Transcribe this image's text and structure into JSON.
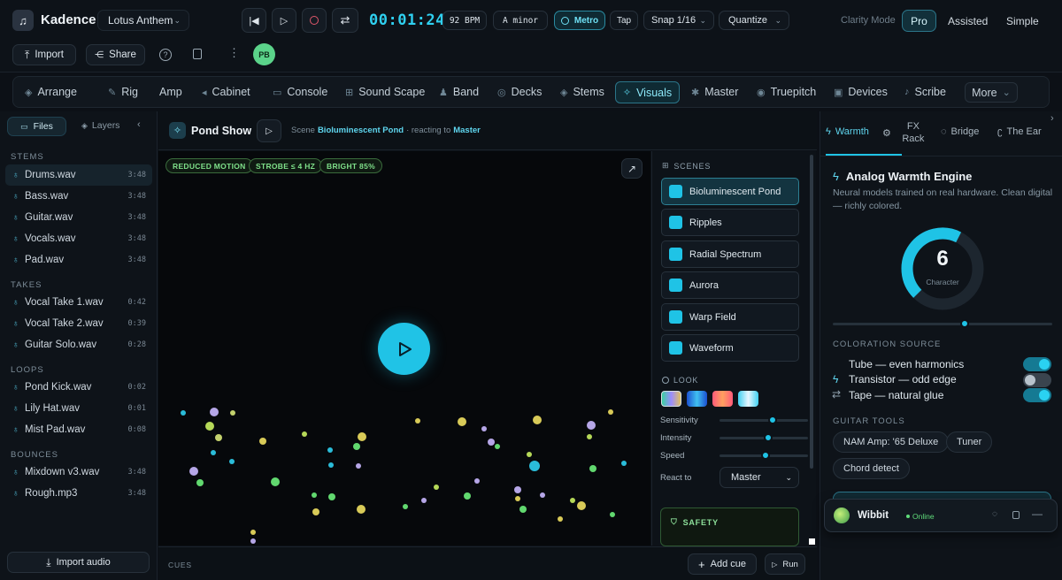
{
  "app": {
    "name": "Kadence",
    "project": "Lotus Anthem"
  },
  "transport": {
    "time": "00:01:24",
    "bpm": "92 BPM",
    "key": "A minor",
    "metro": "Metro",
    "tap": "Tap",
    "snap": "Snap 1/16",
    "quantize": "Quantize"
  },
  "clarity": {
    "label": "Clarity Mode",
    "options": [
      "Pro",
      "Assisted",
      "Simple"
    ],
    "active": "Pro"
  },
  "toolbar": {
    "import": "Import",
    "share": "Share",
    "avatar": "PB"
  },
  "nav": [
    "Arrange",
    "Rig",
    "Amp",
    "Cabinet",
    "Console",
    "Sound Scape",
    "Band",
    "Decks",
    "Stems",
    "Visuals",
    "Master",
    "Truepitch",
    "Devices",
    "Scribe",
    "More"
  ],
  "nav_active": "Visuals",
  "sidebar": {
    "tabs": [
      "Files",
      "Layers"
    ],
    "sections": [
      {
        "title": "STEMS",
        "files": [
          {
            "name": "Drums.wav",
            "dur": "3:48"
          },
          {
            "name": "Bass.wav",
            "dur": "3:48"
          },
          {
            "name": "Guitar.wav",
            "dur": "3:48"
          },
          {
            "name": "Vocals.wav",
            "dur": "3:48"
          },
          {
            "name": "Pad.wav",
            "dur": "3:48"
          }
        ]
      },
      {
        "title": "TAKES",
        "files": [
          {
            "name": "Vocal Take 1.wav",
            "dur": "0:42"
          },
          {
            "name": "Vocal Take 2.wav",
            "dur": "0:39"
          },
          {
            "name": "Guitar Solo.wav",
            "dur": "0:28"
          }
        ]
      },
      {
        "title": "LOOPS",
        "files": [
          {
            "name": "Pond Kick.wav",
            "dur": "0:02"
          },
          {
            "name": "Lily Hat.wav",
            "dur": "0:01"
          },
          {
            "name": "Mist Pad.wav",
            "dur": "0:08"
          }
        ]
      },
      {
        "title": "BOUNCES",
        "files": [
          {
            "name": "Mixdown v3.wav",
            "dur": "3:48"
          },
          {
            "name": "Rough.mp3",
            "dur": "3:48"
          }
        ]
      }
    ],
    "import_audio": "Import audio"
  },
  "stage": {
    "title": "Pond Show",
    "scene_prefix": "Scene",
    "scene_name": "Bioluminescent Pond",
    "reacting_prefix": "· reacting to",
    "reacting_target": "Master",
    "pills": [
      "REDUCED MOTION",
      "STROBE ≤ 4 HZ",
      "BRIGHT 85%"
    ],
    "cues_label": "CUES",
    "add_cue": "Add cue",
    "run": "Run"
  },
  "scenes_panel": {
    "title": "SCENES",
    "scenes": [
      "Bioluminescent Pond",
      "Ripples",
      "Radial Spectrum",
      "Aurora",
      "Warp Field",
      "Waveform"
    ],
    "active": "Bioluminescent Pond",
    "look_title": "LOOK",
    "sliders": [
      {
        "label": "Sensitivity",
        "value": 0.6
      },
      {
        "label": "Intensity",
        "value": 0.55
      },
      {
        "label": "Speed",
        "value": 0.52
      }
    ],
    "react_label": "React to",
    "react_value": "Master",
    "safety_title": "SAFETY"
  },
  "right": {
    "tabs": [
      "Warmth",
      "FX Rack",
      "Bridge",
      "The Ear"
    ],
    "active_tab": "Warmth",
    "engine_title": "Analog Warmth Engine",
    "engine_desc": "Neural models trained on real hardware. Clean digital — richly colored.",
    "character_value": "6",
    "character_label": "Character",
    "character_fraction": 0.6,
    "coloration_title": "COLORATION SOURCE",
    "sources": [
      {
        "label": "Tube — even harmonics",
        "on": true
      },
      {
        "label": "Transistor — odd edge",
        "on": false
      },
      {
        "label": "Tape — natural glue",
        "on": true
      }
    ],
    "guitar_title": "GUITAR TOOLS",
    "guitar_tools": [
      "NAM Amp: '65 Deluxe",
      "Tuner",
      "Chord detect"
    ],
    "assistant": {
      "name": "Wibbit",
      "status": "Online"
    }
  },
  "colors": {
    "accent": "#1fc3e6",
    "bg": "#0c1016",
    "panel": "#0e1319",
    "green": "#7fe08a"
  }
}
